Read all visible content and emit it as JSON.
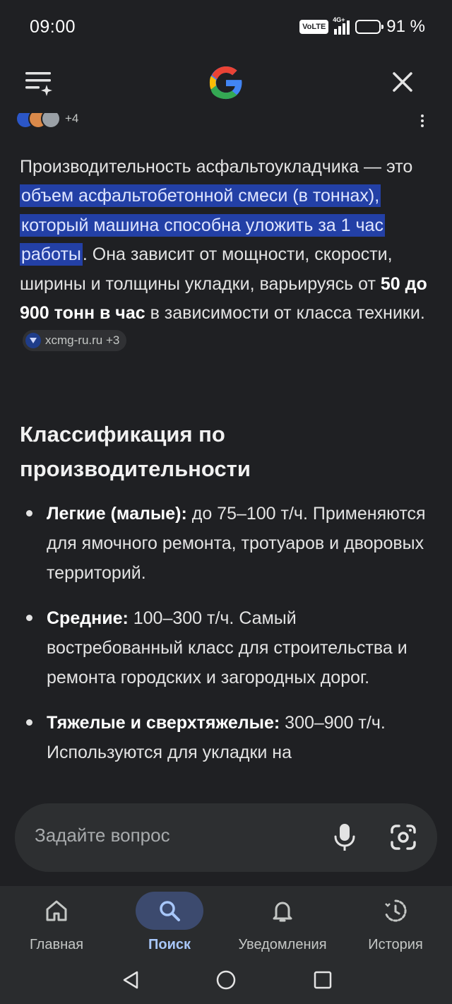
{
  "status": {
    "time": "09:00",
    "volte": "VoLTE",
    "network": "4G+",
    "battery": "91 %",
    "battery_level": 0.91
  },
  "sources": {
    "more": "+4"
  },
  "answer": {
    "p1": "Производительность асфальтоукладчика — это ",
    "highlight": "объем асфальтобетонной смеси (в тоннах), который машина способна уложить за 1 час работы",
    "p2": ". Она зависит от мощности, скорости, ширины и толщины укладки, варьируясь от ",
    "bold": "50 до 900 тонн в час",
    "p3": " в зависимости от класса техники.",
    "chip": "xcmg-ru.ru +3"
  },
  "section": {
    "heading": "Классификация по производительности",
    "items": [
      {
        "term": "Легкие (малые):",
        "text": " до 75–100 т/ч. Применяются для ямочного ремонта, тротуаров и дворовых территорий."
      },
      {
        "term": "Средние:",
        "text": " 100–300 т/ч. Самый востребованный класс для строительства и ремонта городских и загородных дорог."
      },
      {
        "term": "Тяжелые и сверхтяжелые:",
        "text": " 300–900 т/ч. Используются для укладки на"
      }
    ]
  },
  "ask": {
    "placeholder": "Задайте вопрос"
  },
  "nav": {
    "home": "Главная",
    "search": "Поиск",
    "notifications": "Уведомления",
    "history": "История"
  },
  "colors": {
    "background": "#1f2023",
    "highlight": "#2340a6",
    "accent": "#a8c7fa"
  }
}
